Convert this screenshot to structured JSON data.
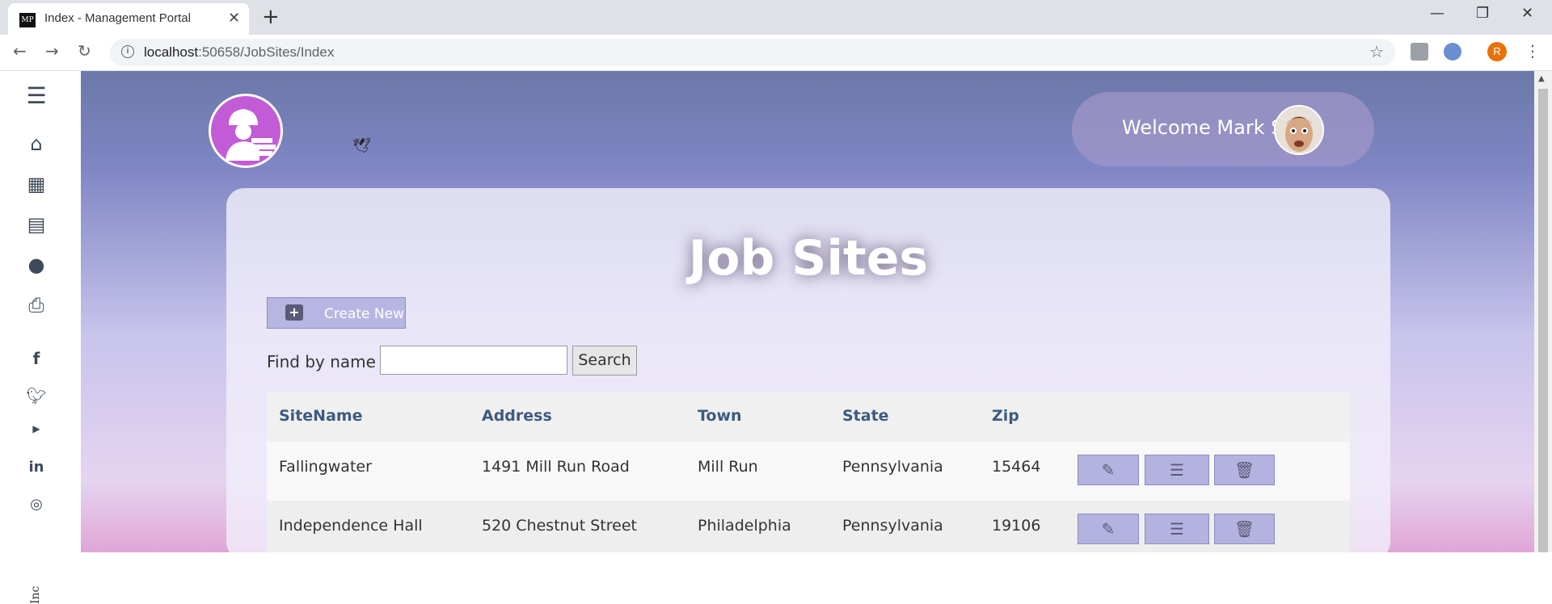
{
  "browser": {
    "tab_title": "Index - Management Portal",
    "favicon_text": "MP",
    "new_tab": "+",
    "url_host": "localhost",
    "url_rest": ":50658/JobSites/Index",
    "profile_initial": "R"
  },
  "header": {
    "welcome": "Welcome Mark S"
  },
  "page": {
    "title": "Job Sites",
    "create_label": "Create New",
    "find_label": "Find by name :",
    "search_value": "",
    "search_button": "Search"
  },
  "sidebar": {
    "icons": [
      "menu-icon",
      "home-icon",
      "calendar-icon",
      "newspaper-icon",
      "comments-icon",
      "print-icon",
      "facebook-icon",
      "twitter-icon",
      "youtube-icon",
      "linkedin-icon",
      "instagram-icon"
    ],
    "vertical_text": "Inc"
  },
  "table": {
    "headers": [
      "SiteName",
      "Address",
      "Town",
      "State",
      "Zip"
    ],
    "rows": [
      {
        "site": "Fallingwater",
        "address": "1491 Mill Run Road",
        "town": "Mill Run",
        "state": "Pennsylvania",
        "zip": "15464"
      },
      {
        "site": "Independence Hall",
        "address": "520 Chestnut Street",
        "town": "Philadelphia",
        "state": "Pennsylvania",
        "zip": "19106"
      }
    ]
  },
  "colors": {
    "accent": "#c25cd6",
    "button": "#b4b3e0",
    "header_text": "#3d5a80"
  }
}
